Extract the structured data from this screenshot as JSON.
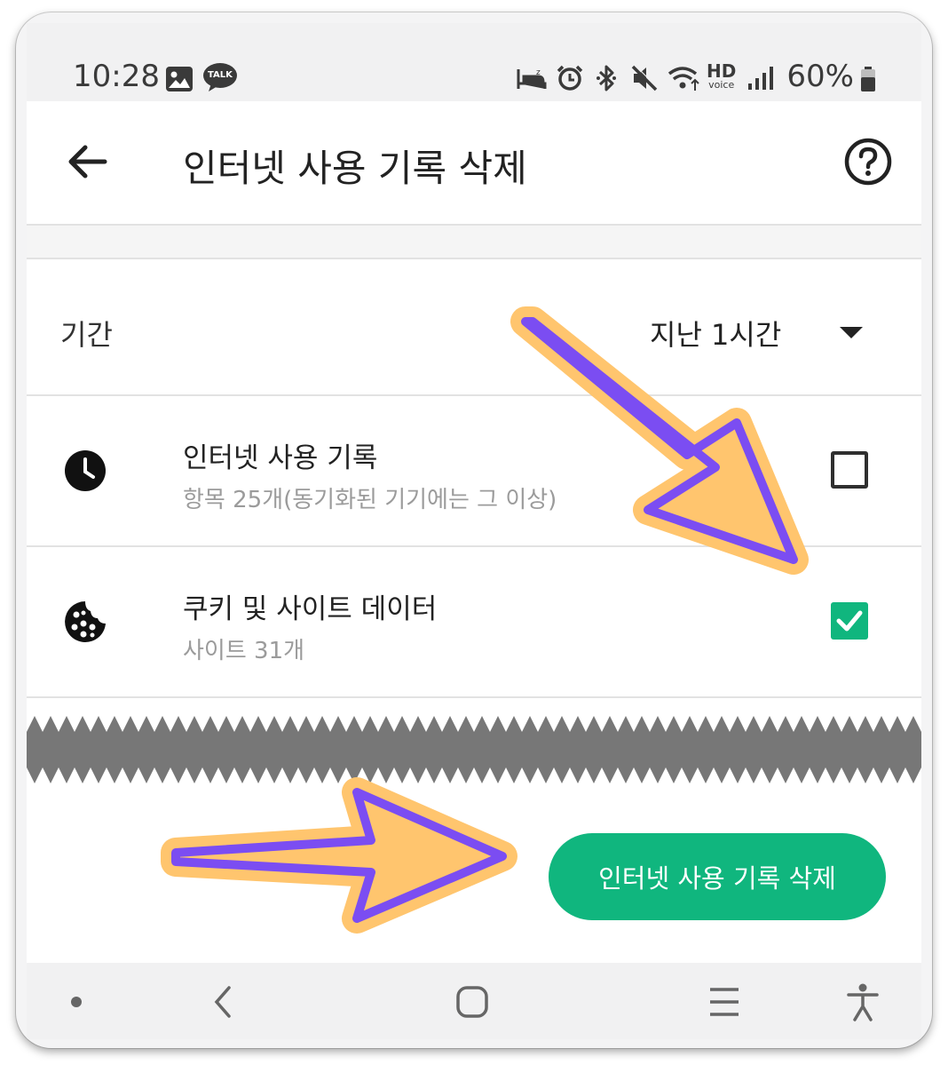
{
  "status_bar": {
    "time": "10:28",
    "battery_percent": "60%",
    "talk_badge": "TALK",
    "hd_label": "HD",
    "voice_label": "voice",
    "icons": [
      "gallery-icon",
      "kakaotalk-icon",
      "sleep-icon",
      "alarm-icon",
      "bluetooth-icon",
      "mute-icon",
      "wifi-icon",
      "hd-voice-icon",
      "signal-icon",
      "battery-icon"
    ]
  },
  "app_bar": {
    "title": "인터넷 사용 기록 삭제",
    "back_icon": "arrow-left-icon",
    "help_icon": "help-circle-icon"
  },
  "period": {
    "label": "기간",
    "value": "지난 1시간"
  },
  "items": [
    {
      "icon": "clock-icon",
      "title": "인터넷 사용 기록",
      "subtitle": "항목 25개(동기화된 기기에는 그 이상)",
      "checked": false
    },
    {
      "icon": "cookie-icon",
      "title": "쿠키 및 사이트 데이터",
      "subtitle": "사이트 31개",
      "checked": true
    }
  ],
  "delete_button": {
    "label": "인터넷 사용 기록 삭제"
  },
  "nav_bar": {
    "icons": [
      "dot-icon",
      "nav-back-icon",
      "home-icon",
      "recents-icon",
      "accessibility-icon"
    ]
  },
  "colors": {
    "accent": "#10b67e",
    "arrow_fill": "#ffc56e",
    "arrow_stroke": "#7b4df2"
  }
}
